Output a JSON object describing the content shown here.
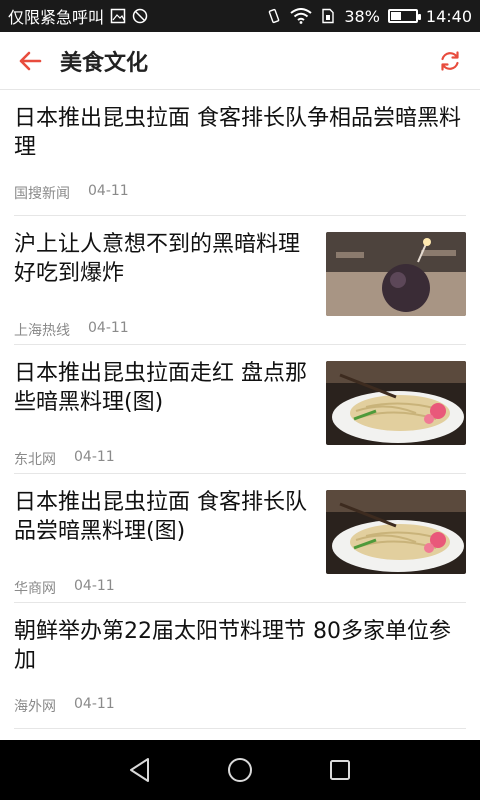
{
  "status_bar": {
    "left_text": "仅限紧急呼叫",
    "battery": "38%",
    "battery_level": 0.38,
    "time": "14:40"
  },
  "header": {
    "title": "美食文化",
    "back_icon": "back-arrow-icon",
    "refresh_icon": "refresh-icon",
    "accent": "#e84c3d"
  },
  "items": [
    {
      "title": "日本推出昆虫拉面 食客排长队争相品尝暗黑料理",
      "source": "国搜新闻",
      "date": "04-11"
    },
    {
      "title": "沪上让人意想不到的黑暗料理 好吃到爆炸",
      "source": "上海热线",
      "date": "04-11"
    },
    {
      "title": "日本推出昆虫拉面走红 盘点那些暗黑料理(图)",
      "source": "东北网",
      "date": "04-11"
    },
    {
      "title": "日本推出昆虫拉面 食客排长队品尝暗黑料理(图)",
      "source": "华商网",
      "date": "04-11"
    },
    {
      "title": "朝鲜举办第22届太阳节料理节 80多家单位参加",
      "source": "海外网",
      "date": "04-11"
    }
  ],
  "nav": {
    "back_icon": "triangle-back-icon",
    "home_icon": "circle-home-icon",
    "recent_icon": "square-recent-icon"
  }
}
